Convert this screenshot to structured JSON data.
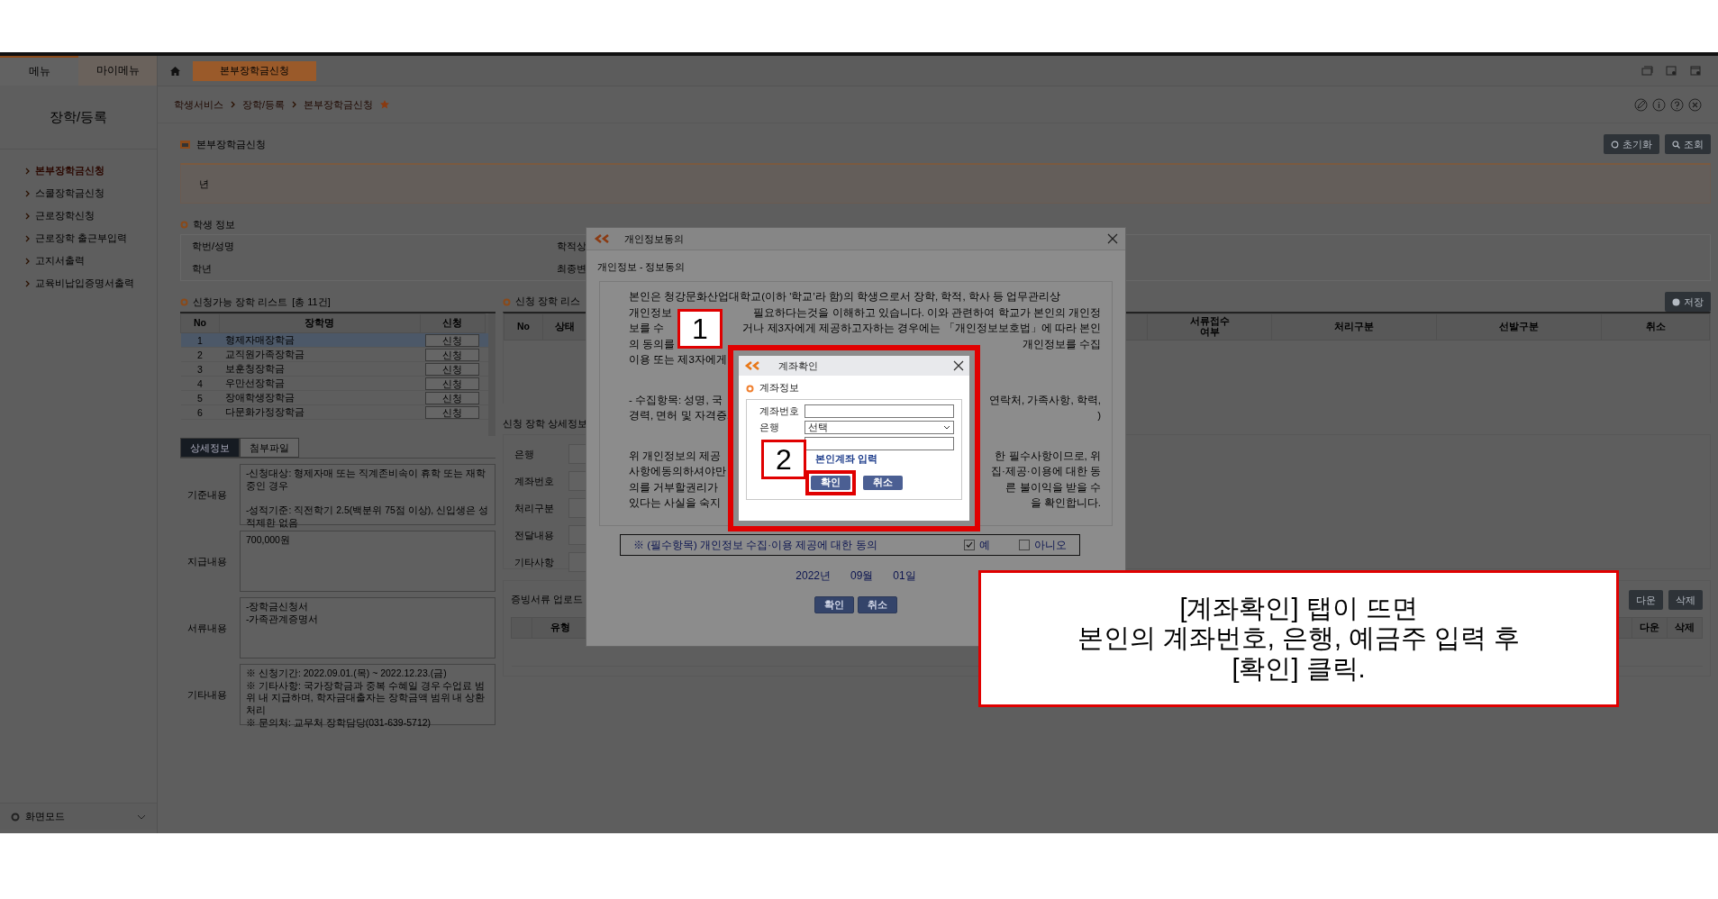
{
  "top_tabs": [
    {
      "label": "메뉴",
      "selected": true
    },
    {
      "label": "마이메뉴",
      "selected": false
    }
  ],
  "open_tab": {
    "label": "본부장학금신청"
  },
  "breadcrumb": [
    "학생서비스",
    "장학/등록",
    "본부장학금신청"
  ],
  "sidebar": {
    "title": "장학/등록",
    "items": [
      {
        "label": "본부장학금신청",
        "selected": true
      },
      {
        "label": "스쿨장학금신청",
        "selected": false
      },
      {
        "label": "근로장학신청",
        "selected": false
      },
      {
        "label": "근로장학 출근부입력",
        "selected": false
      },
      {
        "label": "고지서출력",
        "selected": false
      },
      {
        "label": "교육비납입증명서출력",
        "selected": false
      }
    ],
    "footer": "화면모드"
  },
  "page": {
    "title": "본부장학금신청",
    "buttons": [
      {
        "kind": "reset",
        "label": "초기화"
      },
      {
        "kind": "search",
        "label": "조회"
      }
    ],
    "notice": "년",
    "student": {
      "title": "학생 정보",
      "labels": [
        "학번/성명",
        "학년"
      ],
      "labels_right": [
        "학적상",
        "최종변"
      ]
    },
    "available": {
      "title": "신청가능 장학 리스트",
      "count": "[총 11건]",
      "columns": [
        "No",
        "장학명",
        "신청"
      ],
      "rows": [
        {
          "no": "1",
          "name": "형제자매장학금",
          "action": "신청",
          "selected": true
        },
        {
          "no": "2",
          "name": "교직원가족장학금",
          "action": "신청",
          "selected": false
        },
        {
          "no": "3",
          "name": "보훈청장학금",
          "action": "신청",
          "selected": false
        },
        {
          "no": "4",
          "name": "우만선장학금",
          "action": "신청",
          "selected": false
        },
        {
          "no": "5",
          "name": "장애학생장학금",
          "action": "신청",
          "selected": false
        },
        {
          "no": "6",
          "name": "다문화가정장학금",
          "action": "신청",
          "selected": false
        }
      ]
    },
    "applied": {
      "title": "신청 장학 리스",
      "save": "저장",
      "columns": [
        "No",
        "상태",
        "서류접수 여부",
        "처리구분",
        "선발구분",
        "취소"
      ]
    },
    "detail_tabs": [
      {
        "label": "상세정보",
        "selected": true
      },
      {
        "label": "첨부파일",
        "selected": false
      }
    ],
    "details": [
      {
        "label": "기준내용",
        "text": "-신청대상: 형제자매 또는 직계존비속이 휴학 또는 재학 중인 경우\n\n-성적기준: 직전학기 2.5(백분위 75점 이상), 신입생은 성적제한 없음"
      },
      {
        "label": "지급내용",
        "text": "700,000원"
      },
      {
        "label": "서류내용",
        "text": "-장학금신청서\n-가족관계증명서"
      },
      {
        "label": "기타내용",
        "text": "※ 신청기간: 2022.09.01.(목) ~ 2022.12.23.(금)\n※ 기타사항: 국가장학금과 중복 수혜일 경우 수업료 범위 내 지급하며, 학자금대출자는 장학금액 범위 내 상환처리\n※ 문의처: 교무처 장학담당(031-639-5712)"
      }
    ],
    "applied_detail": {
      "title": "신청 장학 상세정보",
      "labels": [
        "은행",
        "계좌번호",
        "처리구분",
        "전달내용",
        "기타사항"
      ]
    },
    "upload": {
      "title": "증빙서류 업로드",
      "buttons": [
        "다운",
        "삭제"
      ],
      "columns": [
        "유형",
        "다운",
        "삭제"
      ]
    }
  },
  "consent_dialog": {
    "title": "개인정보동의",
    "subtitle": "개인정보 - 정보동의",
    "paragraphs": [
      [
        {
          "left": "본인은 청강문화산업대학교(이하 '학교'라 함)의 학생으로서 장학, 학적, 학사 등 업무관리상"
        },
        {
          "left": "개인정보",
          "right": "필요하다는것을 이해하고 있습니다. 이와 관련하여 학교가 본인의 개인정"
        },
        {
          "left": "보를 수",
          "right": "거나 제3자에게 제공하고자하는 경우에는 「개인정보보호법」에 따라 본인"
        },
        {
          "left": "의 동의를",
          "right": "개인정보를 수집"
        },
        {
          "left": "이용 또는 제3자에게"
        }
      ],
      [
        {
          "left": "- 수집항목: 성명, 국",
          "right": "연락처, 가족사항, 학력,"
        },
        {
          "left": "경력, 면허 및 자격증,",
          "right": ")"
        }
      ],
      [
        {
          "left": "위 개인정보의 제공",
          "right": "한 필수사항이므로, 위"
        },
        {
          "left": "사항에동의하셔야만",
          "right": "집·제공·이용에 대한 동"
        },
        {
          "left": "의를 거부할권리가",
          "right": "른 불이익을 받을 수"
        },
        {
          "left": "있다는 사실을 숙지",
          "right": "을 확인합니다."
        }
      ]
    ],
    "consent_label": "※ (필수항목) 개인정보 수집·이용 제공에 대한 동의",
    "options": [
      {
        "label": "예",
        "checked": true
      },
      {
        "label": "아니오",
        "checked": false
      }
    ],
    "date": [
      "2022년",
      "09월",
      "01일"
    ],
    "buttons": [
      "확인",
      "취소"
    ]
  },
  "account_dialog": {
    "title": "계좌확인",
    "section": "계좌정보",
    "fields": [
      {
        "kind": "text",
        "label": "계좌번호"
      },
      {
        "kind": "select",
        "label": "은행",
        "value": "선택"
      },
      {
        "kind": "text"
      }
    ],
    "link": "본인계좌 입력",
    "buttons": [
      {
        "label": "확인",
        "highlighted": true
      },
      {
        "label": "취소",
        "highlighted": false
      }
    ]
  },
  "markers": [
    "1",
    "2"
  ],
  "callout": {
    "lines": [
      "[계좌확인] 탭이 뜨면",
      "본인의 계좌번호, 은행, 예금주 입력 후",
      "[확인] 클릭."
    ]
  }
}
